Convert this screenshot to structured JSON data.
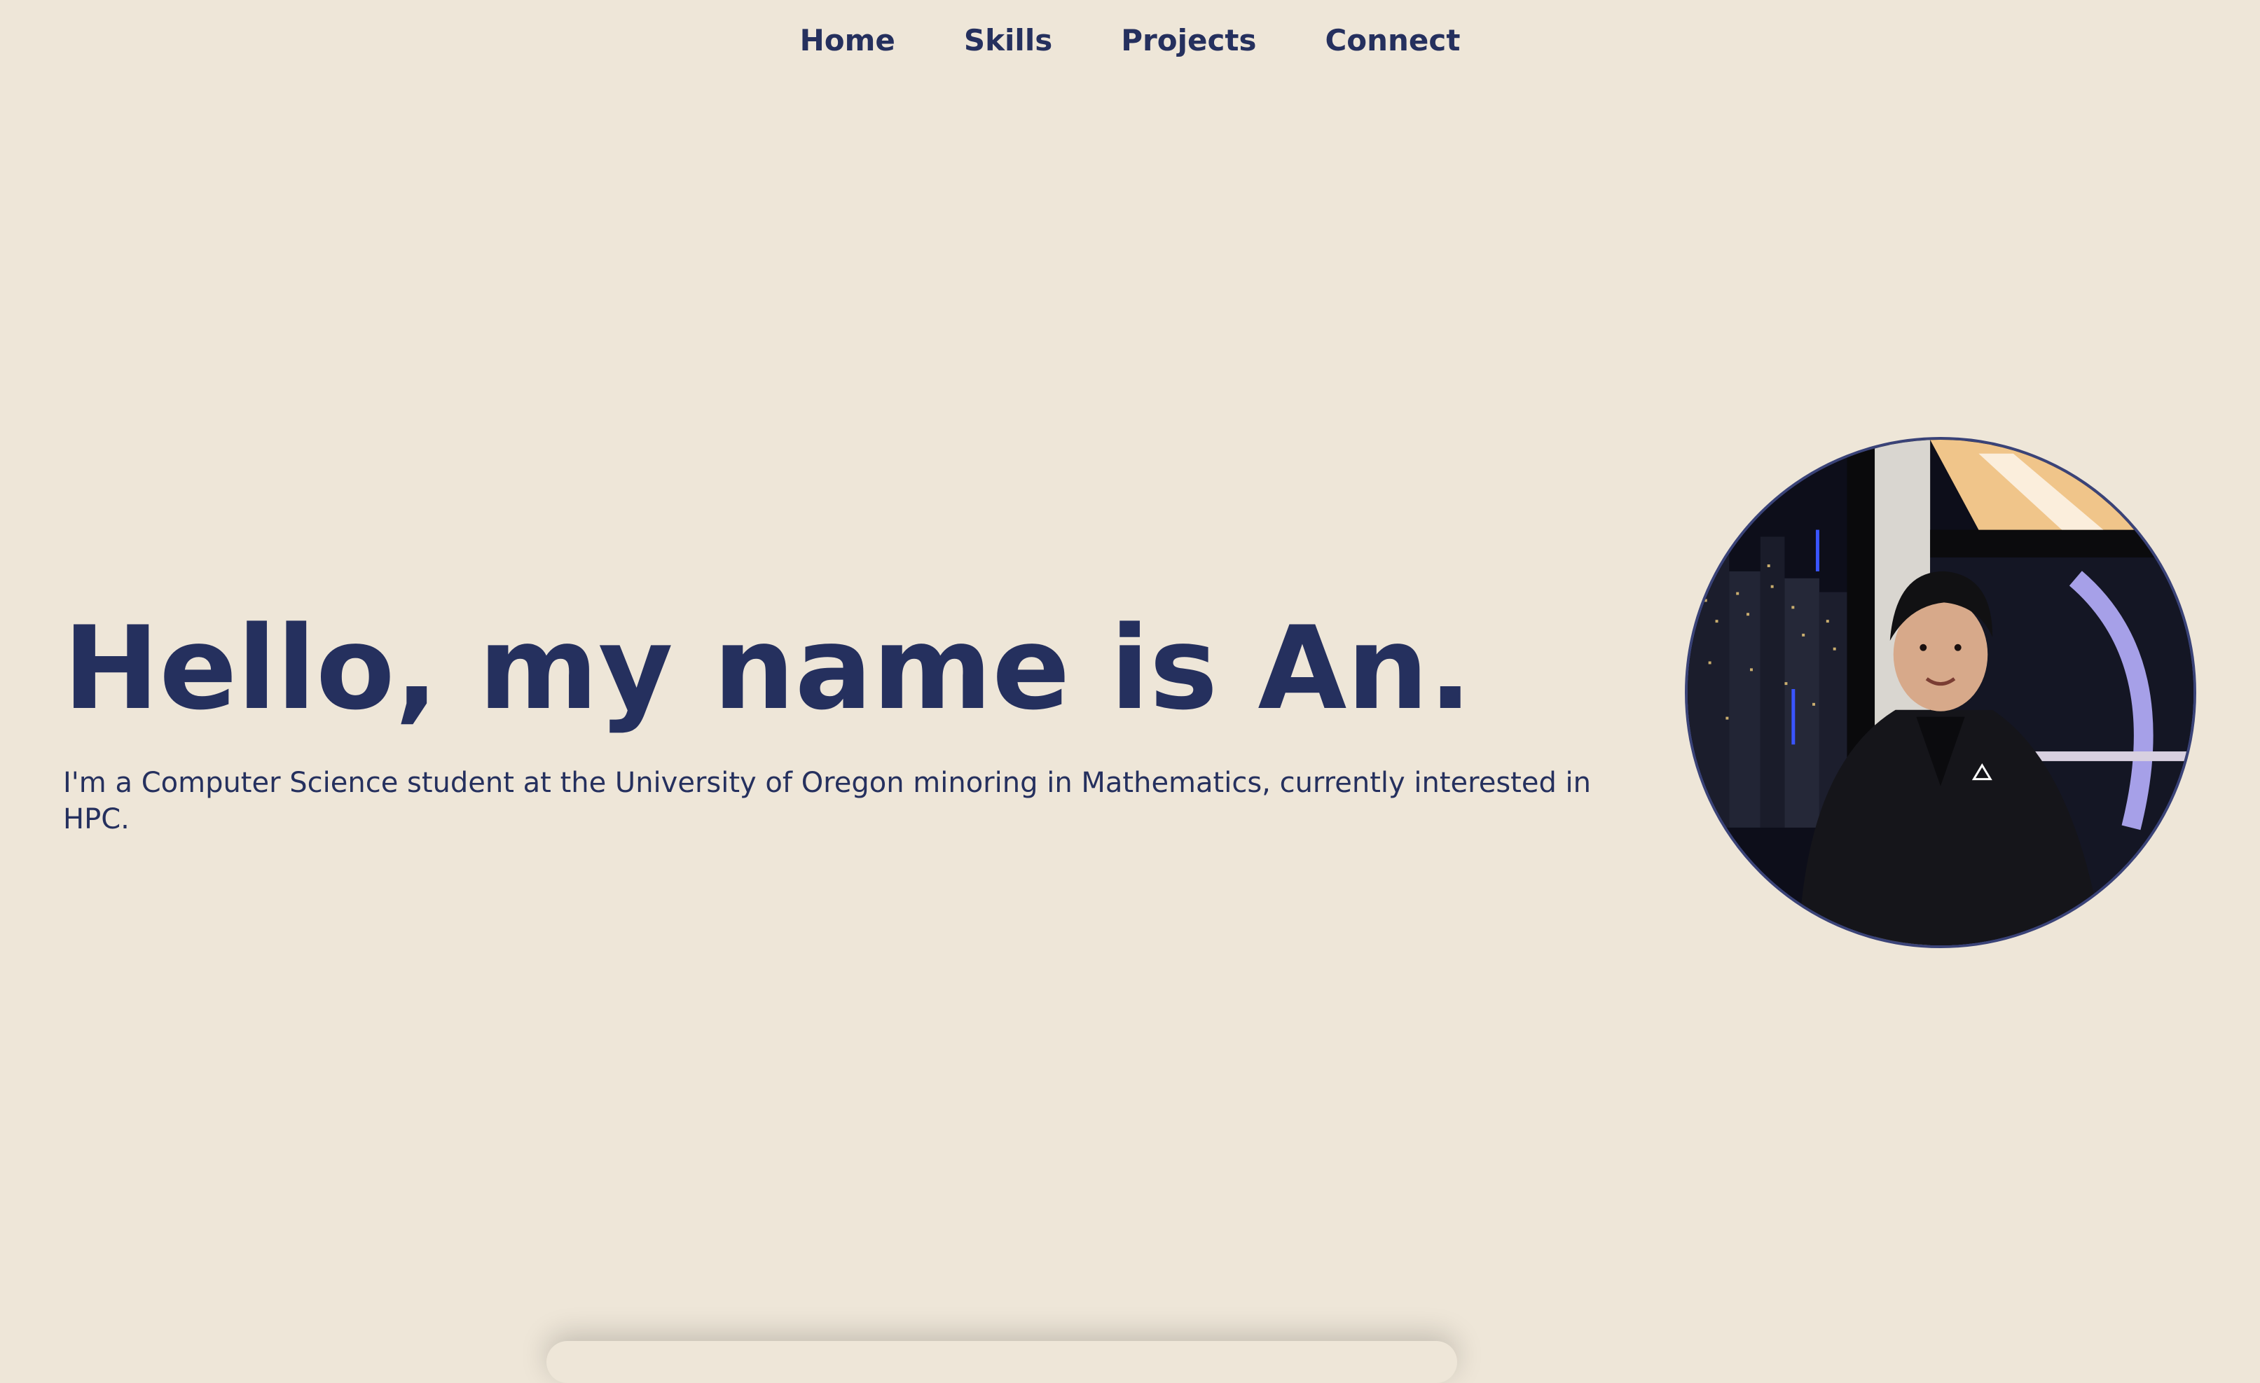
{
  "nav": {
    "items": [
      {
        "label": "Home"
      },
      {
        "label": "Skills"
      },
      {
        "label": "Projects"
      },
      {
        "label": "Connect"
      }
    ]
  },
  "hero": {
    "title": "Hello, my name is An.",
    "subtitle": "I'm a Computer Science student at the University of Oregon minoring in Mathematics, currently interested in HPC."
  },
  "colors": {
    "background": "#EEE6D8",
    "primary_text": "#25305E",
    "avatar_border": "#3A4378"
  },
  "icons": {
    "avatar": "profile-photo"
  }
}
